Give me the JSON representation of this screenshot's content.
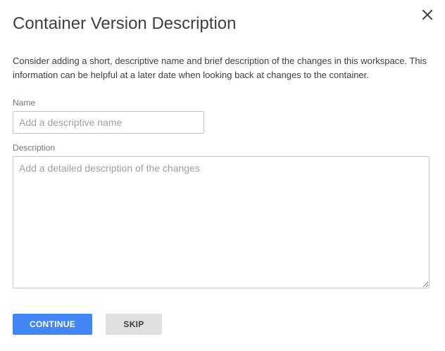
{
  "dialog": {
    "title": "Container Version Description",
    "intro": "Consider adding a short, descriptive name and brief description of the changes in this workspace. This information can be helpful at a later date when looking back at changes to the container.",
    "close_icon": "close-icon"
  },
  "form": {
    "name_label": "Name",
    "name_value": "",
    "name_placeholder": "Add a descriptive name",
    "description_label": "Description",
    "description_value": "",
    "description_placeholder": "Add a detailed description of the changes"
  },
  "actions": {
    "continue_label": "CONTINUE",
    "skip_label": "SKIP"
  },
  "colors": {
    "primary": "#4285f4",
    "secondary_button": "#e0e0e0",
    "text": "#3c4043"
  }
}
